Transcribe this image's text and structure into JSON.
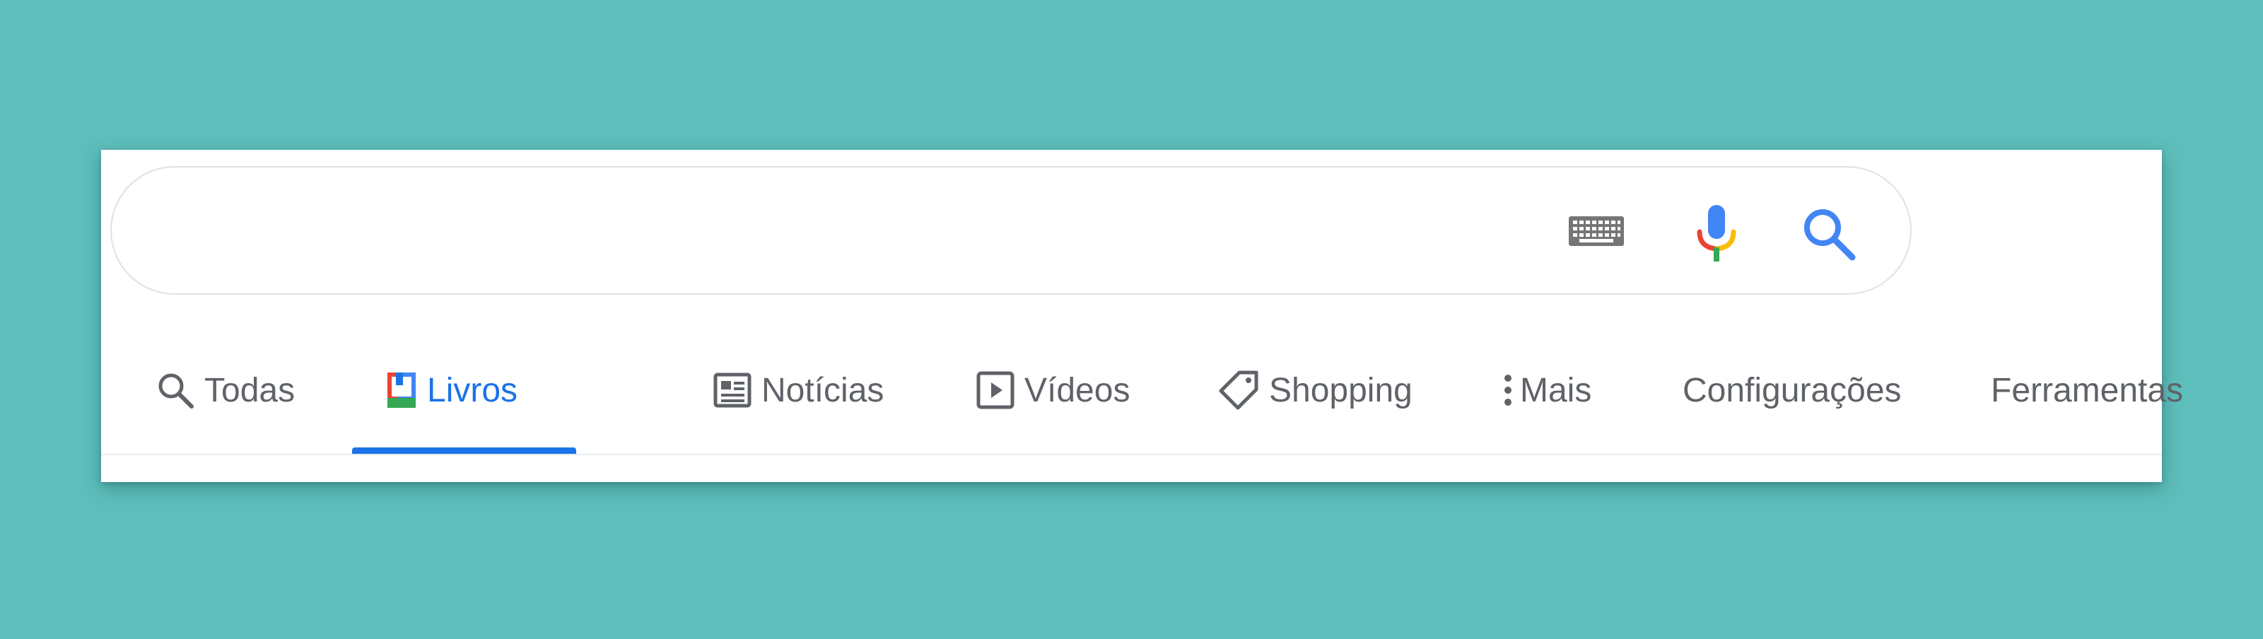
{
  "search": {
    "value": "",
    "placeholder": ""
  },
  "search_icons": {
    "keyboard": "keyboard-icon",
    "mic": "microphone-icon",
    "search": "search-icon"
  },
  "tabs": [
    {
      "label": "Todas",
      "icon": "search-icon",
      "active": false
    },
    {
      "label": "Livros",
      "icon": "books-icon",
      "active": true
    },
    {
      "label": "Notícias",
      "icon": "news-icon",
      "active": false
    },
    {
      "label": "Vídeos",
      "icon": "video-icon",
      "active": false
    },
    {
      "label": "Shopping",
      "icon": "tag-icon",
      "active": false
    },
    {
      "label": "Mais",
      "icon": "more-vertical-icon",
      "active": false
    },
    {
      "label": "Configurações",
      "icon": "",
      "active": false
    },
    {
      "label": "Ferramentas",
      "icon": "",
      "active": false
    }
  ],
  "colors": {
    "background": "#5ebebc",
    "accent": "#1a73e8",
    "tab_text": "#5f6368",
    "google_blue": "#4285f4",
    "google_red": "#ea4335",
    "google_yellow": "#fbbc05",
    "google_green": "#34a853"
  }
}
